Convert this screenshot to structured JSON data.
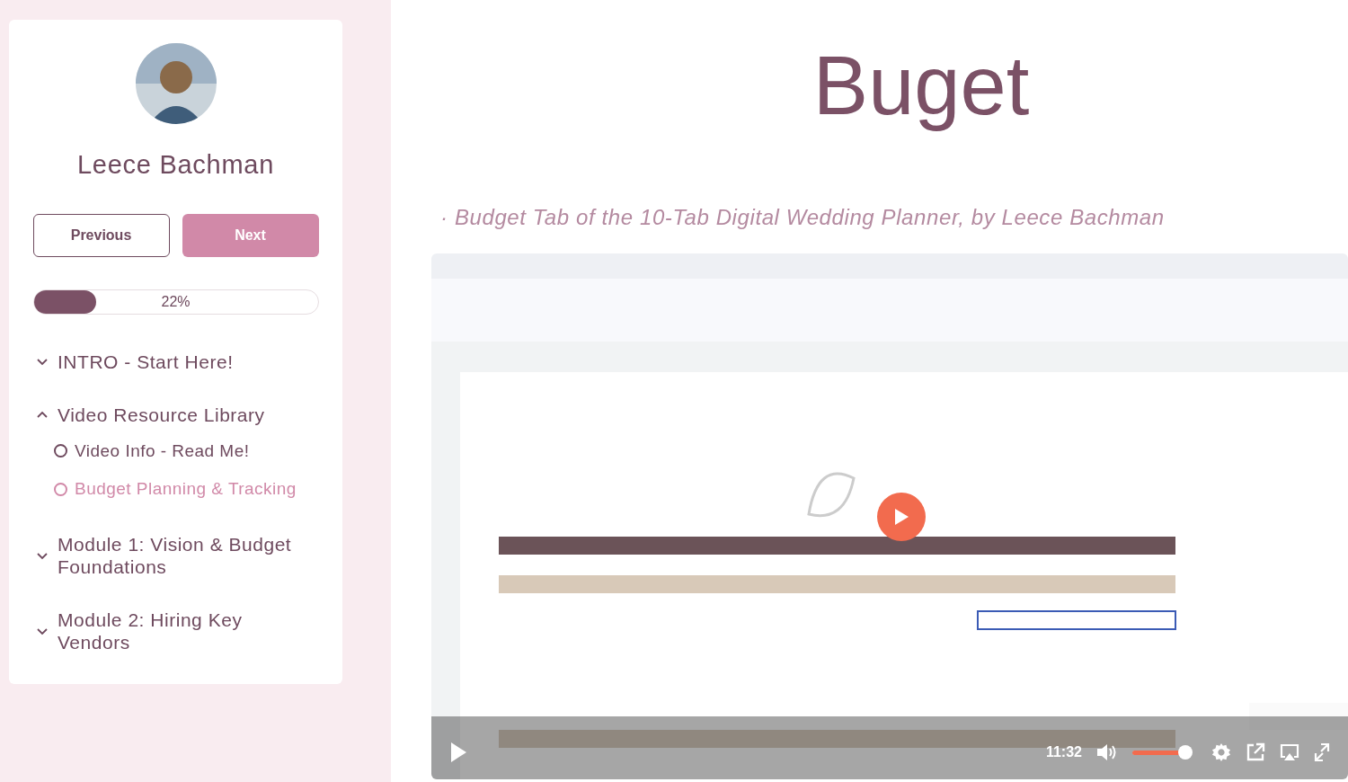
{
  "instructor": {
    "name": "Leece Bachman"
  },
  "nav_buttons": [
    {
      "label": "Previous",
      "kind": "outline"
    },
    {
      "label": "Next",
      "kind": "filled"
    }
  ],
  "progress": {
    "level": 0.22,
    "reading": "22%"
  },
  "outline": [
    {
      "title": "INTRO - Start Here!",
      "expanded": false
    },
    {
      "title": "Video Resource Library",
      "expanded": true,
      "children": [
        {
          "title": "Video Info - Read Me!",
          "selected": false
        },
        {
          "title": "Budget Planning & Tracking",
          "selected": true
        }
      ]
    },
    {
      "title": "Module 1: Vision & Budget Foundations",
      "expanded": false
    },
    {
      "title": "Module 2: Hiring Key Vendors",
      "expanded": false
    }
  ],
  "lesson": {
    "title": "Buget",
    "bullet": "·",
    "caption": "Budget Tab of the 10-Tab Digital Wedding Planner, by Leece Bachman"
  },
  "video": {
    "kind": "picture",
    "time": "11:32",
    "volume": {
      "level": 0.92
    }
  }
}
